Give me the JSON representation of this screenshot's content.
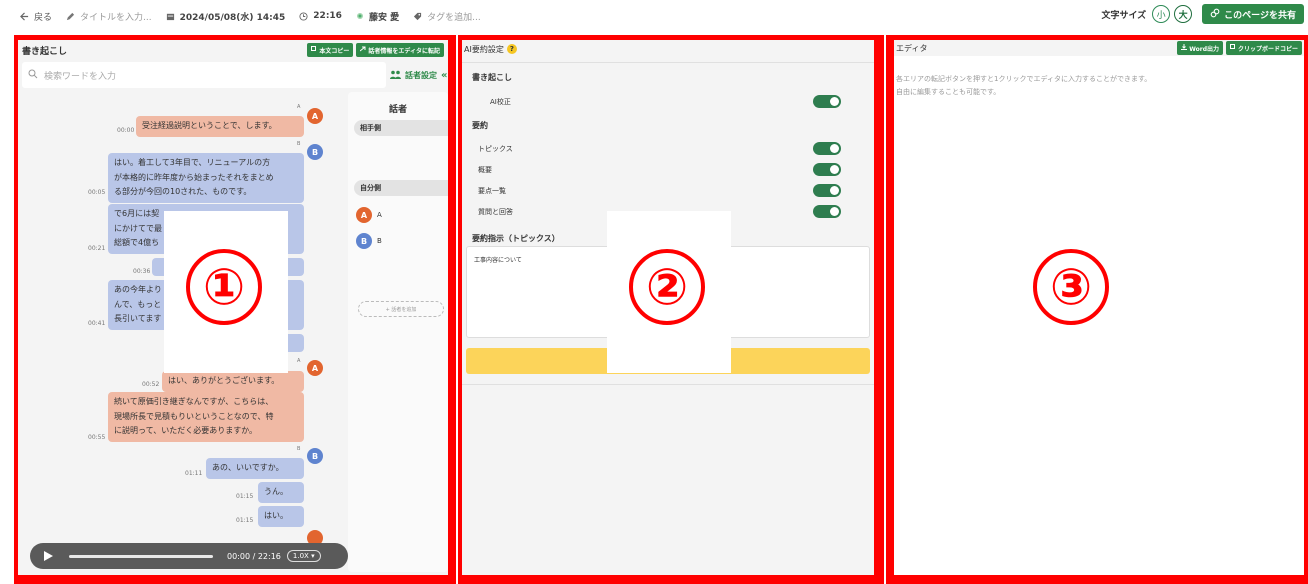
{
  "topbar": {
    "back": "戻る",
    "title_placeholder": "タイトルを入力...",
    "datetime": "2024/05/08(水) 14:45",
    "duration": "22:16",
    "user": "藤安 愛",
    "tag_placeholder": "タグを追加...",
    "font_size_label": "文字サイズ",
    "font_small": "小",
    "font_large": "大",
    "share": "このページを共有"
  },
  "panel1": {
    "title": "書き起こし",
    "copy_text": "本文コピー",
    "transfer": "話者情報をエディタに転記",
    "search_placeholder": "検索ワードを入力",
    "speaker_settings": "話者設定",
    "messages": [
      {
        "speaker": "A",
        "time": "00:00",
        "lines": [
          "受注経過説明ということで、します。"
        ]
      },
      {
        "speaker": "B",
        "time": "00:05",
        "lines": [
          "はい。着工して3年目で、リニューアルの方",
          "が本格的に昨年度から始まったそれをまとめ",
          "る部分が今回の10された、ものです。"
        ]
      },
      {
        "speaker": "B",
        "time": "00:21",
        "lines": [
          "で6月には契",
          "にかけてで最",
          "総額で4億ち"
        ]
      },
      {
        "speaker": "B",
        "time": "00:36",
        "lines": [
          ""
        ]
      },
      {
        "speaker": "B",
        "time": "00:41",
        "lines": [
          "あの今年より",
          "んで、もっと",
          "長引いてます"
        ]
      },
      {
        "speaker": "A",
        "time": "00:52",
        "lines": [
          "はい、ありがとうございます。"
        ]
      },
      {
        "speaker": "A",
        "time": "00:55",
        "lines": [
          "続いて原価引き継ぎなんですが、こちらは、",
          "現場所長で見積もりいということなので、特",
          "に説明って、いただく必要ありますか。"
        ]
      },
      {
        "speaker": "B",
        "time": "01:11",
        "lines": [
          "あの、いいですか。"
        ]
      },
      {
        "speaker": "B",
        "time": "01:15",
        "lines": [
          "うん。"
        ]
      },
      {
        "speaker": "B",
        "time": "01:15",
        "lines": [
          "はい。"
        ]
      }
    ],
    "player": {
      "time": "00:00 / 22:16",
      "speed": "1.0X",
      "progress": 0.0
    },
    "speakers": {
      "title": "話者",
      "other_side": "相手側",
      "self_side": "自分側",
      "people": [
        "A",
        "B"
      ],
      "add": "+ 話者を追加"
    }
  },
  "panel2": {
    "title": "AI要約設定",
    "help": "?",
    "transcription": "書き起こし",
    "ai_correct": "AI校正",
    "summary": "要約",
    "options": [
      "トピックス",
      "概要",
      "要点一覧",
      "質問と回答"
    ],
    "instruction_title": "要約指示（トピックス）",
    "instruction_text": "工事内容について"
  },
  "panel3": {
    "title": "エディタ",
    "word_export": "Word出力",
    "clipboard": "クリップボードコピー",
    "hint_line1": "各エリアの転記ボタンを押すと1クリックでエディタに入力することができます。",
    "hint_line2": "自由に編集することも可能です。"
  },
  "overlays": [
    "①",
    "②",
    "③"
  ],
  "colors": {
    "frame": "#ff0000",
    "accent_green": "#2f8a4a",
    "bubble_a": "#f0b9a4",
    "bubble_b": "#b9c6e8",
    "generate_button": "#fcd45a"
  }
}
